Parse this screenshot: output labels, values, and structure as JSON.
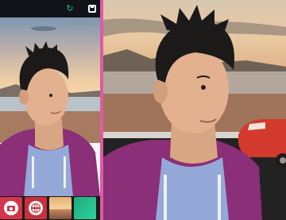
{
  "app": {
    "header": {
      "refresh_icon": "refresh-icon",
      "save_icon": "save-icon"
    },
    "accent_color": "#e05aa3",
    "thumbnails": [
      {
        "name": "camera-thumb",
        "icon": "camera-icon",
        "color": "#d3364c"
      },
      {
        "name": "globe-thumb",
        "icon": "globe-icon",
        "color": "#c8303e"
      },
      {
        "name": "beach-background-thumb",
        "icon": "beach-image"
      },
      {
        "name": "app-thumb",
        "icon": "app-image",
        "color": "#1fa97a"
      }
    ]
  },
  "preview": {
    "left_photo": "person-on-beach-sunset",
    "right_photo": "person-on-beach-with-red-car"
  }
}
